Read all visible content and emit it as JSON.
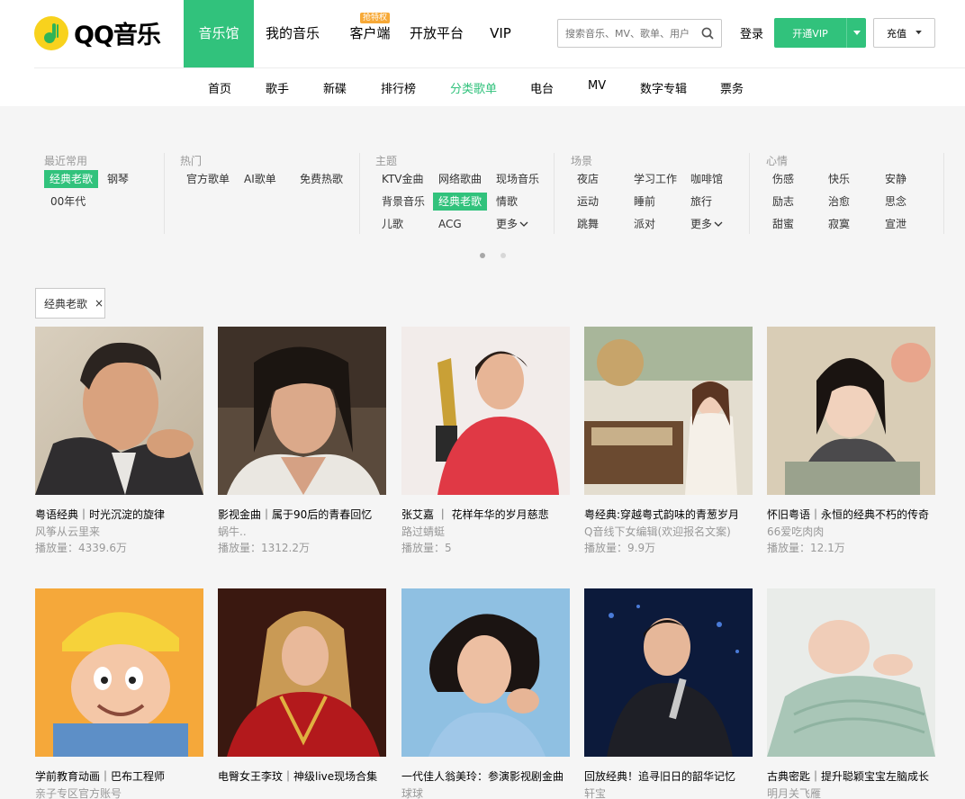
{
  "brand": {
    "name": "QQ音乐"
  },
  "main_nav": [
    {
      "label": "音乐馆",
      "active": true
    },
    {
      "label": "我的音乐"
    },
    {
      "label": "客户端",
      "badge": "抢特权"
    },
    {
      "label": "开放平台"
    },
    {
      "label": "VIP"
    }
  ],
  "search": {
    "placeholder": "搜索音乐、MV、歌单、用户"
  },
  "header": {
    "login": "登录",
    "vip_button": "开通VIP",
    "recharge_button": "充值"
  },
  "sub_nav": [
    {
      "label": "首页"
    },
    {
      "label": "歌手"
    },
    {
      "label": "新碟"
    },
    {
      "label": "排行榜"
    },
    {
      "label": "分类歌单",
      "active": true
    },
    {
      "label": "电台"
    },
    {
      "label": "MV"
    },
    {
      "label": "数字专辑"
    },
    {
      "label": "票务"
    }
  ],
  "categories": {
    "recent": {
      "title": "最近常用",
      "tags": [
        "经典老歌",
        "钢琴",
        "00年代"
      ]
    },
    "hot": {
      "title": "热门",
      "tags": [
        "官方歌单",
        "AI歌单",
        "免费热歌"
      ]
    },
    "theme": {
      "title": "主题",
      "tags": [
        "KTV金曲",
        "网络歌曲",
        "现场音乐",
        "背景音乐",
        "经典老歌",
        "情歌",
        "儿歌",
        "ACG",
        "更多"
      ]
    },
    "scene": {
      "title": "场景",
      "tags": [
        "夜店",
        "学习工作",
        "咖啡馆",
        "运动",
        "睡前",
        "旅行",
        "跳舞",
        "派对",
        "更多"
      ]
    },
    "mood": {
      "title": "心情",
      "tags": [
        "伤感",
        "快乐",
        "安静",
        "励志",
        "治愈",
        "思念",
        "甜蜜",
        "寂寞",
        "宣泄"
      ]
    },
    "active_tag": "经典老歌"
  },
  "selected_filter": {
    "label": "经典老歌",
    "remove": "×"
  },
  "playlists": [
    {
      "title": "粤语经典｜时光沉淀的旋律",
      "author": "风筝从云里来",
      "plays": "播放量：4339.6万"
    },
    {
      "title": "影视金曲｜属于90后的青春回忆",
      "author": "蜗牛..",
      "plays": "播放量：1312.2万"
    },
    {
      "title": "张艾嘉 ｜ 花样年华的岁月慈悲",
      "author": "路过蜻蜓",
      "plays": "播放量：5"
    },
    {
      "title": "粤经典:穿越粤式韵味的青葱岁月",
      "author": "Q音线下女编辑(欢迎报名文案)",
      "plays": "播放量：9.9万"
    },
    {
      "title": "怀旧粤语｜永恒的经典不朽的传奇",
      "author": "66爱吃肉肉",
      "plays": "播放量：12.1万"
    },
    {
      "title": "学前教育动画｜巴布工程师",
      "author": "亲子专区官方账号",
      "plays": ""
    },
    {
      "title": "电臀女王李玟｜神级live现场合集",
      "author": "",
      "plays": ""
    },
    {
      "title": "一代佳人翁美玲：参演影视剧金曲",
      "author": "球球",
      "plays": ""
    },
    {
      "title": "回放经典！追寻旧日的韶华记忆",
      "author": "轩宝",
      "plays": ""
    },
    {
      "title": "古典密匙｜提升聪颖宝宝左脑成长",
      "author": "明月关飞雁",
      "plays": ""
    }
  ],
  "colors": {
    "accent": "#31c27c",
    "badge": "#f7a937",
    "logo_yellow": "#f8d21d"
  },
  "icons": {
    "search": "search-icon",
    "remove": "close-icon",
    "dropdown": "caret-down-icon"
  }
}
